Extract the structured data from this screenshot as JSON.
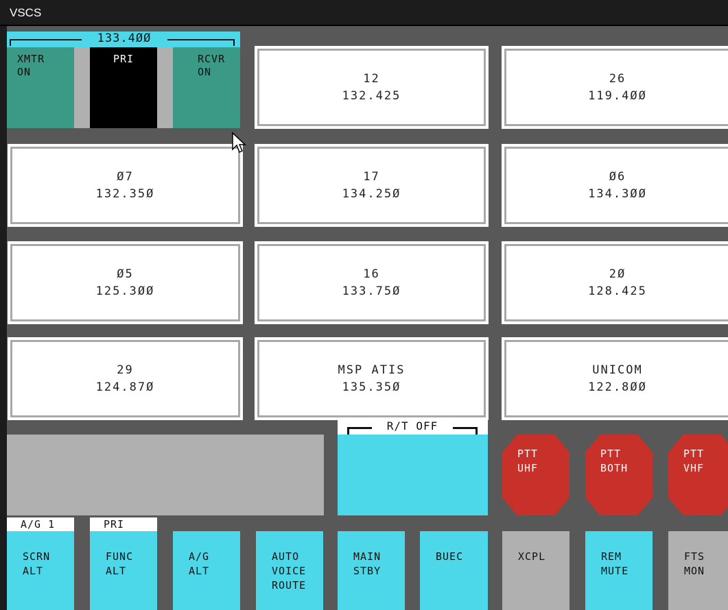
{
  "window": {
    "title": "VSCS"
  },
  "ag_main": {
    "frequency": "133.4ØØ",
    "xmtr": [
      "XMTR",
      "ON"
    ],
    "pri": "PRI",
    "rcvr": [
      "RCVR",
      "ON"
    ]
  },
  "freq_buttons": [
    {
      "id": "12",
      "freq": "132.425"
    },
    {
      "id": "26",
      "freq": "119.4ØØ"
    },
    {
      "id": "Ø7",
      "freq": "132.35Ø"
    },
    {
      "id": "17",
      "freq": "134.25Ø"
    },
    {
      "id": "Ø6",
      "freq": "134.3ØØ"
    },
    {
      "id": "Ø5",
      "freq": "125.3ØØ"
    },
    {
      "id": "16",
      "freq": "133.75Ø"
    },
    {
      "id": "2Ø",
      "freq": "128.425"
    },
    {
      "id": "29",
      "freq": "124.87Ø"
    },
    {
      "id": "MSP ATIS",
      "freq": "135.35Ø"
    },
    {
      "id": "UNICOM",
      "freq": "122.8ØØ"
    }
  ],
  "rt": {
    "label": "R/T OFF"
  },
  "ptt": [
    {
      "line1": "PTT",
      "line2": "UHF"
    },
    {
      "line1": "PTT",
      "line2": "BOTH"
    },
    {
      "line1": "PTT",
      "line2": "VHF"
    }
  ],
  "tabs": {
    "ag1": "A/G 1",
    "pri": "PRI"
  },
  "function_keys": [
    {
      "lines": [
        "SCRN",
        "ALT"
      ]
    },
    {
      "lines": [
        "FUNC",
        "ALT"
      ]
    },
    {
      "lines": [
        "A/G",
        "ALT"
      ]
    },
    {
      "lines": [
        "AUTO",
        "VOICE",
        "ROUTE"
      ]
    },
    {
      "lines": [
        "MAIN",
        "STBY"
      ]
    },
    {
      "lines": [
        "BUEC"
      ]
    },
    {
      "lines": [
        "XCPL"
      ]
    },
    {
      "lines": [
        "REM",
        "MUTE"
      ]
    },
    {
      "lines": [
        "FTS",
        "MON"
      ]
    }
  ],
  "colors": {
    "cyan": "#4dd8ea",
    "teal": "#3a9a86",
    "ptt_red": "#c8302a",
    "panel_gray": "#585858"
  }
}
